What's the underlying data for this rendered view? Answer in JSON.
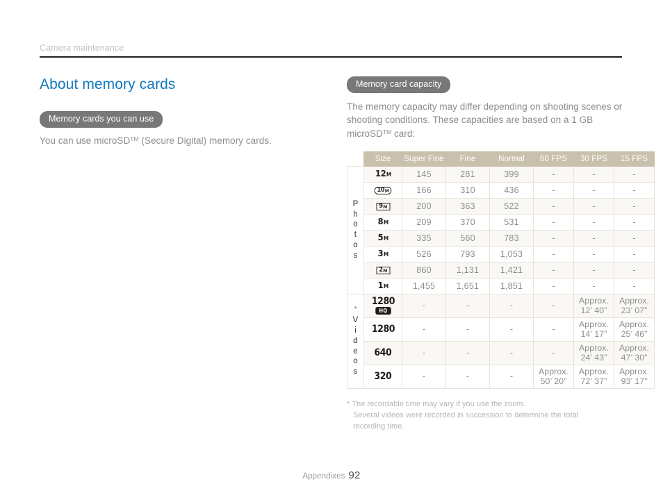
{
  "running_head": "Camera maintenance",
  "page_title": "About memory cards",
  "left": {
    "section_label": "Memory cards you can use",
    "body_prefix": "You can use microSD",
    "body_tm": "TM",
    "body_suffix": " (Secure Digital) memory cards."
  },
  "right": {
    "section_label": "Memory card capacity",
    "intro_prefix": "The memory capacity may differ depending on shooting scenes or shooting conditions. These capacities are based on a 1 GB microSD",
    "intro_tm": "TM",
    "intro_suffix": " card:"
  },
  "table": {
    "headers": [
      "Size",
      "Super Fine",
      "Fine",
      "Normal",
      "60 FPS",
      "30 FPS",
      "15 FPS"
    ],
    "group_photos": "Photos",
    "group_videos": "Videos",
    "group_videos_marker": "*",
    "photo_rows": [
      {
        "size_num": "12",
        "size_unit": "M",
        "style": "plain",
        "cells": [
          "145",
          "281",
          "399",
          "-",
          "-",
          "-"
        ]
      },
      {
        "size_num": "10",
        "size_unit": "M",
        "style": "frame-round",
        "cells": [
          "166",
          "310",
          "436",
          "-",
          "-",
          "-"
        ]
      },
      {
        "size_num": "9",
        "size_unit": "M",
        "style": "frame",
        "cells": [
          "200",
          "363",
          "522",
          "-",
          "-",
          "-"
        ]
      },
      {
        "size_num": "8",
        "size_unit": "M",
        "style": "plain",
        "cells": [
          "209",
          "370",
          "531",
          "-",
          "-",
          "-"
        ]
      },
      {
        "size_num": "5",
        "size_unit": "M",
        "style": "plain",
        "cells": [
          "335",
          "560",
          "783",
          "-",
          "-",
          "-"
        ]
      },
      {
        "size_num": "3",
        "size_unit": "M",
        "style": "plain",
        "cells": [
          "526",
          "793",
          "1,053",
          "-",
          "-",
          "-"
        ]
      },
      {
        "size_num": "2",
        "size_unit": "M",
        "style": "frame",
        "cells": [
          "860",
          "1,131",
          "1,421",
          "-",
          "-",
          "-"
        ]
      },
      {
        "size_num": "1",
        "size_unit": "M",
        "style": "plain",
        "cells": [
          "1,455",
          "1,651",
          "1,851",
          "-",
          "-",
          "-"
        ]
      }
    ],
    "video_rows": [
      {
        "size_num": "1280",
        "badge": "HQ",
        "cells": [
          "-",
          "-",
          "-",
          "-",
          "Approx.|12’ 40”",
          "Approx.|23’ 07”"
        ]
      },
      {
        "size_num": "1280",
        "badge": "",
        "cells": [
          "-",
          "-",
          "-",
          "-",
          "Approx.|14’ 17”",
          "Approx.|25’ 46”"
        ]
      },
      {
        "size_num": "640",
        "badge": "",
        "cells": [
          "-",
          "-",
          "-",
          "-",
          "Approx.|24’ 43”",
          "Approx.|47’ 30”"
        ]
      },
      {
        "size_num": "320",
        "badge": "",
        "cells": [
          "-",
          "-",
          "-",
          "Approx.|50’ 20”",
          "Approx.|72’ 37”",
          "Approx.|93’ 17”"
        ]
      }
    ]
  },
  "footnote": {
    "marker": "*",
    "line1": "The recordable time may vary if you use the zoom.",
    "line2": "Several videos were recorded in succession to determine the total",
    "line3": "recording time."
  },
  "footer": {
    "label": "Appendixes",
    "page_number": "92"
  },
  "colors": {
    "title_blue": "#1277bc",
    "pill_gray": "#77787a",
    "table_header_tan": "#c9c0ad",
    "row_alt": "#faf8f4",
    "body_gray": "#8d8d8d"
  }
}
